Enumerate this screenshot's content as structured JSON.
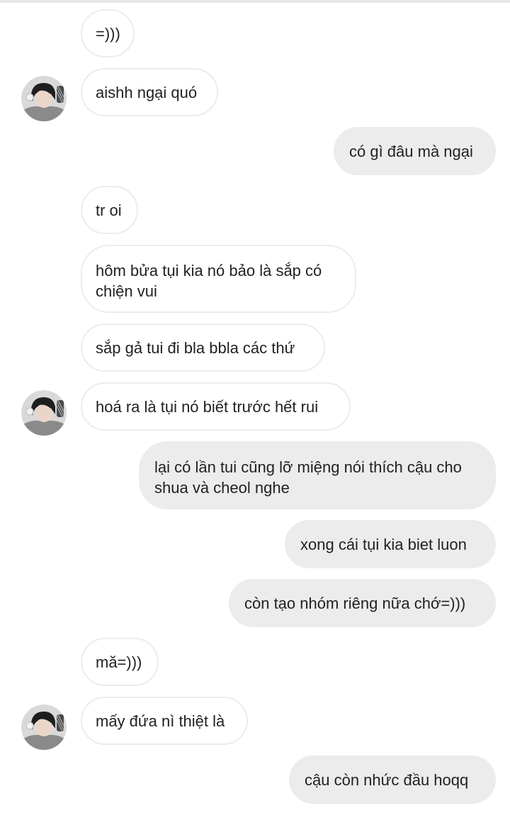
{
  "messages": [
    {
      "id": 1,
      "sender": "them",
      "text": "=)))"
    },
    {
      "id": 2,
      "sender": "them",
      "text": "aishh ngại quó",
      "avatar": true
    },
    {
      "id": 3,
      "sender": "me",
      "text": "có gì đâu mà ngại"
    },
    {
      "id": 4,
      "sender": "them",
      "text": "tr oi"
    },
    {
      "id": 5,
      "sender": "them",
      "text": "hôm bửa tụi kia nó bảo là sắp có chiện vui"
    },
    {
      "id": 6,
      "sender": "them",
      "text": "sắp gả tui đi bla bbla các thứ"
    },
    {
      "id": 7,
      "sender": "them",
      "text": "hoá ra là tụi nó biết trước hết rui",
      "avatar": true
    },
    {
      "id": 8,
      "sender": "me",
      "text": "lại có lần tui cũng lỡ miệng nói thích cậu cho shua và cheol nghe"
    },
    {
      "id": 9,
      "sender": "me",
      "text": "xong cái tụi kia biet luon"
    },
    {
      "id": 10,
      "sender": "me",
      "text": "còn tạo nhóm riêng nữa chớ=)))"
    },
    {
      "id": 11,
      "sender": "them",
      "text": "mă=)))"
    },
    {
      "id": 12,
      "sender": "them",
      "text": "mấy đứa nì thiệt là",
      "avatar": true
    },
    {
      "id": 13,
      "sender": "me",
      "text": "cậu còn nhức đầu hoqq"
    }
  ],
  "colors": {
    "incoming_bubble": "#ffffff",
    "incoming_border": "#ececec",
    "outgoing_bubble": "#ececec",
    "text": "#222222"
  },
  "icons": {
    "avatar": "contact-avatar-icon"
  }
}
